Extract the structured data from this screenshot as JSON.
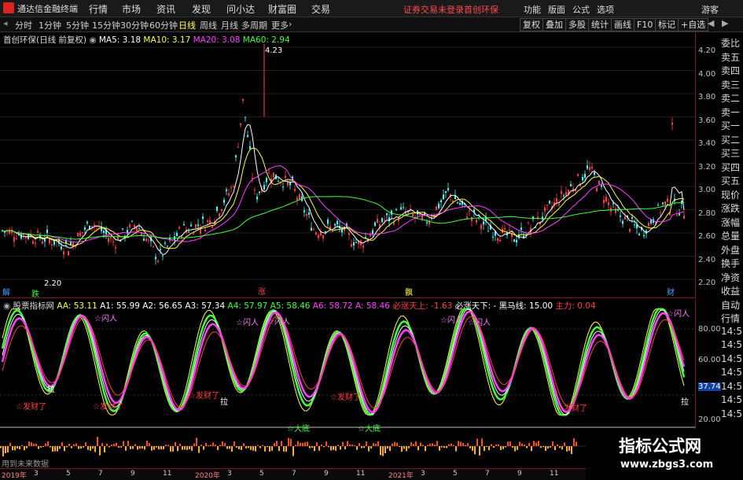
{
  "app": {
    "title": "通达信金融终端"
  },
  "menu": [
    "行情",
    "市场",
    "资讯",
    "发现",
    "问小达",
    "财富圈",
    "交易"
  ],
  "menu_notice": [
    "证券交易未登录",
    "首创环保"
  ],
  "menu_right": [
    "功能",
    "版面",
    "公式",
    "选项",
    "游客"
  ],
  "tabs": [
    "分时",
    "1分钟",
    "5分钟",
    "15分钟",
    "30分钟",
    "60分钟",
    "日线",
    "周线",
    "月线",
    "多周期",
    "更多"
  ],
  "active_tab": "日线",
  "toolbar_right": [
    "复权",
    "叠加",
    "多股",
    "统计",
    "画线",
    "F10",
    "标记",
    "+自选"
  ],
  "main": {
    "name": "首创环保(日线 前复权)",
    "ma": [
      {
        "label": "MA5: 3.18",
        "color": "#ffffff"
      },
      {
        "label": "MA10: 3.17",
        "color": "#ffff40"
      },
      {
        "label": "MA20: 3.08",
        "color": "#ff40ff"
      },
      {
        "label": "MA60: 2.94",
        "color": "#40ff40"
      }
    ],
    "y_ticks": [
      "4.20",
      "4.00",
      "3.80",
      "3.60",
      "3.40",
      "3.20",
      "3.00",
      "2.80",
      "2.60",
      "2.40",
      "2.20"
    ],
    "high_label": "4.23",
    "low_label": "2.20",
    "markers": [
      "解",
      "跌",
      "涨",
      "飘",
      "财"
    ]
  },
  "indicator": {
    "name": "股票指标网",
    "items": [
      {
        "label": "AA: 53.11",
        "color": "#ffff40"
      },
      {
        "label": "A1: 55.99",
        "color": "#ffffff"
      },
      {
        "label": "A2: 56.65",
        "color": "#ffffff"
      },
      {
        "label": "A3: 57.34",
        "color": "#ffffff"
      },
      {
        "label": "A4: 57.97",
        "color": "#40ff40"
      },
      {
        "label": "A5: 58.46",
        "color": "#40ff40"
      },
      {
        "label": "A6: 58.72",
        "color": "#ff40ff"
      },
      {
        "label": "A: 58.46",
        "color": "#ff40ff"
      },
      {
        "label": "必涨天上: -1.63",
        "color": "#ff4040"
      },
      {
        "label": "必涨天下: -",
        "color": "#ffffff"
      },
      {
        "label": "黑马线: 15.00",
        "color": "#ffffff"
      },
      {
        "label": "主力: 0.04",
        "color": "#ff4040"
      }
    ],
    "y_ticks": [
      "80.00",
      "60.00",
      "37.74",
      "20.00"
    ],
    "annotations": [
      "闪人",
      "闪人",
      "闪人",
      "闪人",
      "闪人",
      "闪人",
      "发财了",
      "发财了",
      "发财了",
      "发财了",
      "发财了",
      "大底",
      "大底",
      "拉",
      "拉",
      "拉"
    ]
  },
  "right_panel": [
    "委比",
    "卖五",
    "卖四",
    "卖三",
    "卖二",
    "卖一",
    "买一",
    "买二",
    "买三",
    "买四",
    "买五",
    "现价",
    "涨跌",
    "涨幅",
    "总量",
    "外盘",
    "换手",
    "净资",
    "收益",
    "自动",
    "行情",
    "14:5",
    "14:5",
    "14:5",
    "14:5",
    "14:5",
    "14:5",
    "14:5"
  ],
  "bottom": {
    "no_data": "用到未来数据",
    "axis": [
      "2019年",
      "3",
      "5",
      "7",
      "9",
      "11",
      "2020年",
      "3",
      "5",
      "7",
      "9",
      "11",
      "2021年",
      "3",
      "5",
      "7",
      "9",
      "11"
    ]
  },
  "watermark": {
    "line1": "指标公式网",
    "line2": "www.zbgs3.com"
  }
}
